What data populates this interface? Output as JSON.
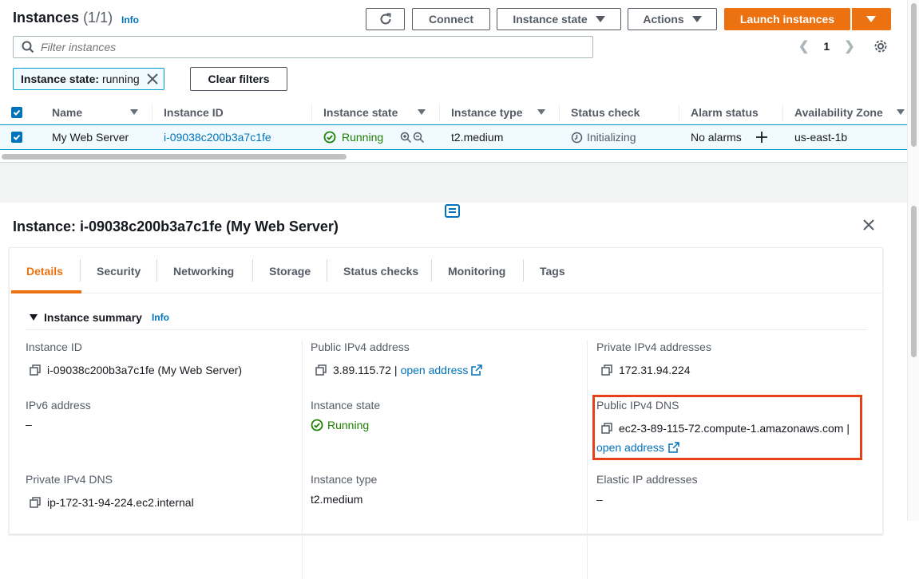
{
  "header": {
    "title": "Instances",
    "count": "(1/1)",
    "info": "Info",
    "connect": "Connect",
    "instance_state": "Instance state",
    "actions": "Actions",
    "launch": "Launch instances"
  },
  "search": {
    "placeholder": "Filter instances"
  },
  "pager": {
    "page": "1"
  },
  "filter": {
    "key": "Instance state:",
    "value": "running",
    "clear": "Clear filters"
  },
  "table": {
    "columns": [
      "Name",
      "Instance ID",
      "Instance state",
      "Instance type",
      "Status check",
      "Alarm status",
      "Availability Zone"
    ],
    "row": {
      "name": "My Web Server",
      "id": "i-09038c200b3a7c1fe",
      "state": "Running",
      "type": "t2.medium",
      "status": "Initializing",
      "alarm": "No alarms",
      "az": "us-east-1b"
    }
  },
  "detail": {
    "title": "Instance: i-09038c200b3a7c1fe (My Web Server)",
    "tabs": [
      "Details",
      "Security",
      "Networking",
      "Storage",
      "Status checks",
      "Monitoring",
      "Tags"
    ],
    "summary": "Instance summary",
    "info": "Info",
    "fields": {
      "instance_id_label": "Instance ID",
      "instance_id": "i-09038c200b3a7c1fe (My Web Server)",
      "public_ip_label": "Public IPv4 address",
      "public_ip": "3.89.115.72",
      "open_address": "open address",
      "private_ip_label": "Private IPv4 addresses",
      "private_ip": "172.31.94.224",
      "ipv6_label": "IPv6 address",
      "ipv6": "–",
      "state_label": "Instance state",
      "state": "Running",
      "public_dns_label": "Public IPv4 DNS",
      "public_dns": "ec2-3-89-115-72.compute-1.amazonaws.com |",
      "private_dns_label": "Private IPv4 DNS",
      "private_dns": "ip-172-31-94-224.ec2.internal",
      "type_label": "Instance type",
      "type": "t2.medium",
      "eip_label": "Elastic IP addresses",
      "eip": "–"
    }
  },
  "colors": {
    "accent": "#ec7211",
    "link": "#0073bb",
    "success": "#1d8102",
    "highlight": "#e5421b"
  }
}
